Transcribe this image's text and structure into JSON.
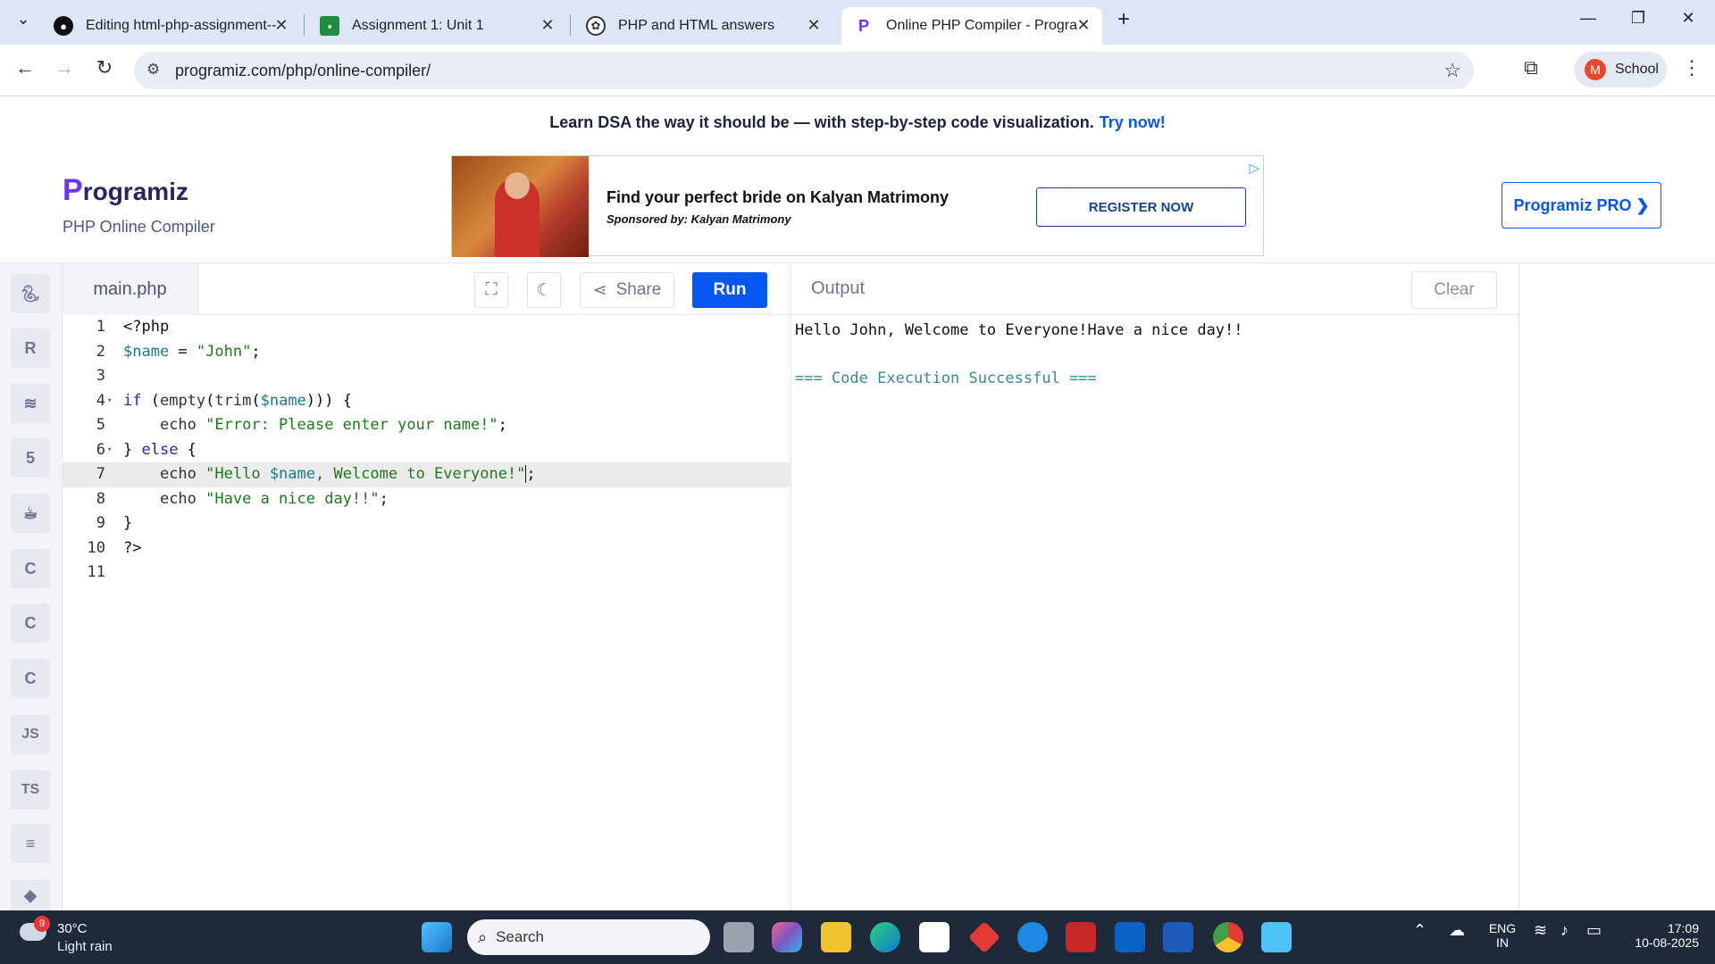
{
  "browser": {
    "tabs": [
      {
        "title": "Editing html-php-assignment--",
        "icon": "github-icon"
      },
      {
        "title": "Assignment 1: Unit 1",
        "icon": "classroom-icon"
      },
      {
        "title": "PHP and HTML answers",
        "icon": "chatgpt-icon"
      },
      {
        "title": "Online PHP Compiler - Program",
        "icon": "programiz-icon"
      }
    ],
    "new_tab": "+",
    "url": "programiz.com/php/online-compiler/",
    "profile_initial": "M",
    "profile_name": "School"
  },
  "banner": {
    "text": "Learn DSA the way it should be — with step-by-step code visualization.",
    "link": "Try now!"
  },
  "brand": {
    "logo": "rogramiz",
    "logo_p": "P",
    "subtitle": "PHP Online Compiler"
  },
  "ad": {
    "headline": "Find your perfect bride on Kalyan Matrimony",
    "sponsor": "Sponsored by: Kalyan Matrimony",
    "cta": "REGISTER NOW"
  },
  "pro_button": "Programiz PRO ❯",
  "sidebar": {
    "items": [
      "python-icon",
      "r-icon",
      "sql-icon",
      "html-icon",
      "java-icon",
      "c-icon",
      "cpp-icon",
      "csharp-icon",
      "JS",
      "TS",
      "go-icon",
      "swift-icon"
    ],
    "js": "JS",
    "ts": "TS"
  },
  "editor": {
    "filename": "main.php",
    "share": "Share",
    "run": "Run",
    "line_numbers": [
      "1",
      "2",
      "3",
      "4",
      "5",
      "6",
      "7",
      "8",
      "9",
      "10",
      "11"
    ]
  },
  "output": {
    "title": "Output",
    "clear": "Clear",
    "line1": "Hello John, Welcome to Everyone!Have a nice day!!",
    "line2": "=== Code Execution Successful ==="
  },
  "taskbar": {
    "weather_badge": "9",
    "temperature": "30°C",
    "condition": "Light rain",
    "search": "Search",
    "lang1": "ENG",
    "lang2": "IN",
    "time": "17:09",
    "date": "10-08-2025"
  }
}
